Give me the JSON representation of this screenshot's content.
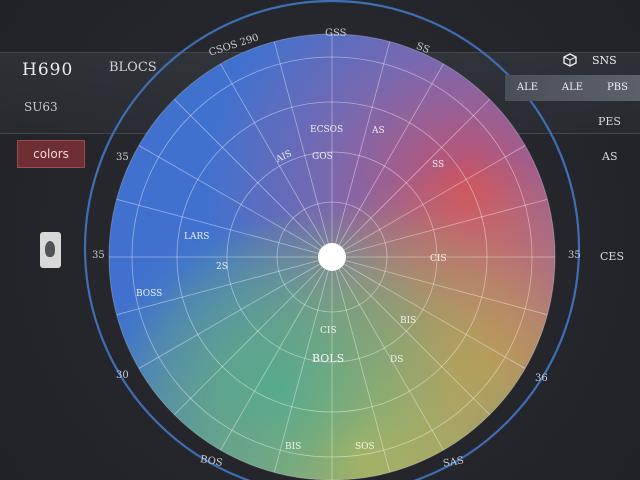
{
  "header": {
    "title": "H690",
    "subtitle": "BLOCS",
    "subtitle_2": "SU63"
  },
  "left_panel": {
    "colors_button_label": "colors"
  },
  "right_panel": {
    "head_label": "SNS",
    "tabs": [
      {
        "label": "ALE"
      },
      {
        "label": "ALE"
      },
      {
        "label": "PBS"
      }
    ],
    "labels": [
      "PES",
      "AS",
      "CES"
    ]
  },
  "ring_labels": {
    "top": "GSS",
    "top_left": "CSOS 290",
    "top_right": "SS",
    "left_upper": "35",
    "left_mid": "35",
    "left_lower": "30",
    "right_mid": "35",
    "right_lower": "36",
    "bottom_left": "BOS",
    "bottom_right": "SAS"
  },
  "wheel_labels": {
    "center_upper": "ECSOS",
    "upper_small": "AS",
    "mid_left": "AIS",
    "mid_left_2": "GOS",
    "left_a": "LARS",
    "left_b": "2S",
    "left_c": "BOSS",
    "lower_mid": "CIS",
    "lower_center": "BOLS",
    "lower_right": "DS",
    "bottom_a": "BIS",
    "bottom_b": "SOS",
    "right_a": "SS",
    "right_b": "CIS",
    "right_c": "BIS"
  },
  "colors": {
    "background": "#24262c",
    "ring": "#3e6fb2",
    "button": "#6e2e33",
    "wheel_blue": "#3a74d2",
    "wheel_red": "#df4a50",
    "wheel_orange": "#ef8a3e",
    "wheel_yellow": "#d9c442",
    "wheel_green": "#4cb58a"
  },
  "icons": {
    "right_header": "cube-icon",
    "side_handle": "drag-handle-icon"
  }
}
